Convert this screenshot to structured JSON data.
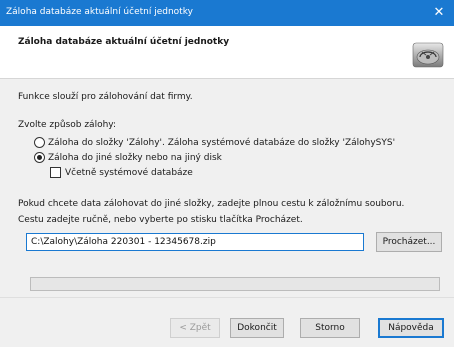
{
  "window": {
    "title": "Záloha databáze aktuální účetní jednotky",
    "close_glyph": "✕"
  },
  "header": {
    "heading": "Záloha databáze aktuální účetní jednotky",
    "logo_icon": "database-backup-icon"
  },
  "content": {
    "intro": "Funkce slouží pro zálohování dat firmy.",
    "choose_label": "Zvolte způsob zálohy:",
    "options": [
      {
        "label": "Záloha do složky 'Zálohy'. Záloha systémové databáze do složky 'ZálohySYS'",
        "selected": false
      },
      {
        "label": "Záloha do jiné složky nebo na jiný disk",
        "selected": true
      }
    ],
    "include_system_label": "Včetně systémové databáze",
    "include_system_checked": false,
    "path_hint_1": "Pokud chcete data zálohovat do jiné složky, zadejte plnou cestu k záložnímu souboru.",
    "path_hint_2": "Cestu zadejte ručně, nebo vyberte po stisku tlačítka Procházet.",
    "path_value": "C:\\Zalohy\\Záloha 220301 - 12345678.zip",
    "browse_label": "Procházet...",
    "progress_fraction": 0
  },
  "footer": {
    "back_label": "< Zpět",
    "finish_label": "Dokončit",
    "cancel_label": "Storno",
    "help_label": "Nápověda"
  }
}
